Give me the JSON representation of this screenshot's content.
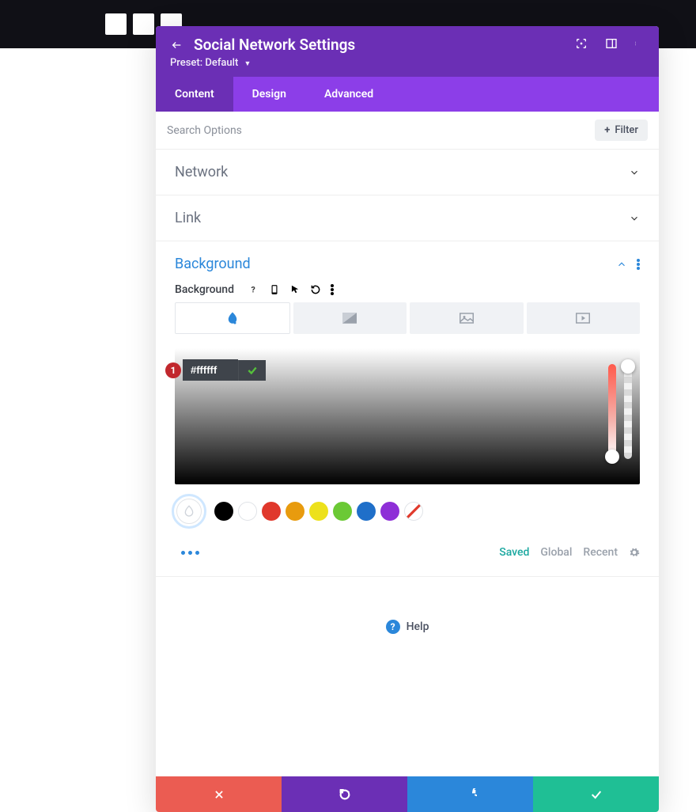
{
  "header": {
    "title": "Social Network Settings",
    "preset_label": "Preset: Default"
  },
  "tabs": {
    "content": "Content",
    "design": "Design",
    "advanced": "Advanced"
  },
  "search": {
    "placeholder": "Search Options",
    "filter_label": "Filter"
  },
  "sections": {
    "network": "Network",
    "link": "Link",
    "background": "Background"
  },
  "background": {
    "sub_label": "Background",
    "hex_value": "#ffffff",
    "annotation_badge": "1"
  },
  "palette": {
    "saved": "Saved",
    "global": "Global",
    "recent": "Recent"
  },
  "help": {
    "label": "Help"
  }
}
